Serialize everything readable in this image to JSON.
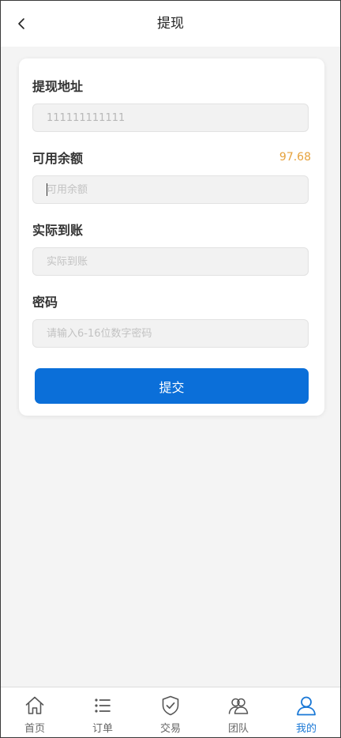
{
  "header": {
    "title": "提现",
    "back_icon": "chevron-left-icon"
  },
  "form": {
    "address": {
      "label": "提现地址",
      "value": "111111111111"
    },
    "balance": {
      "label": "可用余额",
      "amount": "97.68",
      "placeholder": "可用余额"
    },
    "received": {
      "label": "实际到账",
      "placeholder": "实际到账"
    },
    "password": {
      "label": "密码",
      "placeholder": "请输入6-16位数字密码"
    },
    "submit_label": "提交"
  },
  "tabbar": {
    "items": [
      {
        "label": "首页",
        "icon": "home-icon"
      },
      {
        "label": "订单",
        "icon": "list-icon"
      },
      {
        "label": "交易",
        "icon": "shield-check-icon"
      },
      {
        "label": "团队",
        "icon": "team-icon"
      },
      {
        "label": "我的",
        "icon": "user-icon"
      }
    ],
    "active_index": 4
  },
  "colors": {
    "accent": "#0b6fd9",
    "active_tab": "#1a78d6",
    "balance_amount": "#e6a23c",
    "background": "#f4f4f4"
  }
}
